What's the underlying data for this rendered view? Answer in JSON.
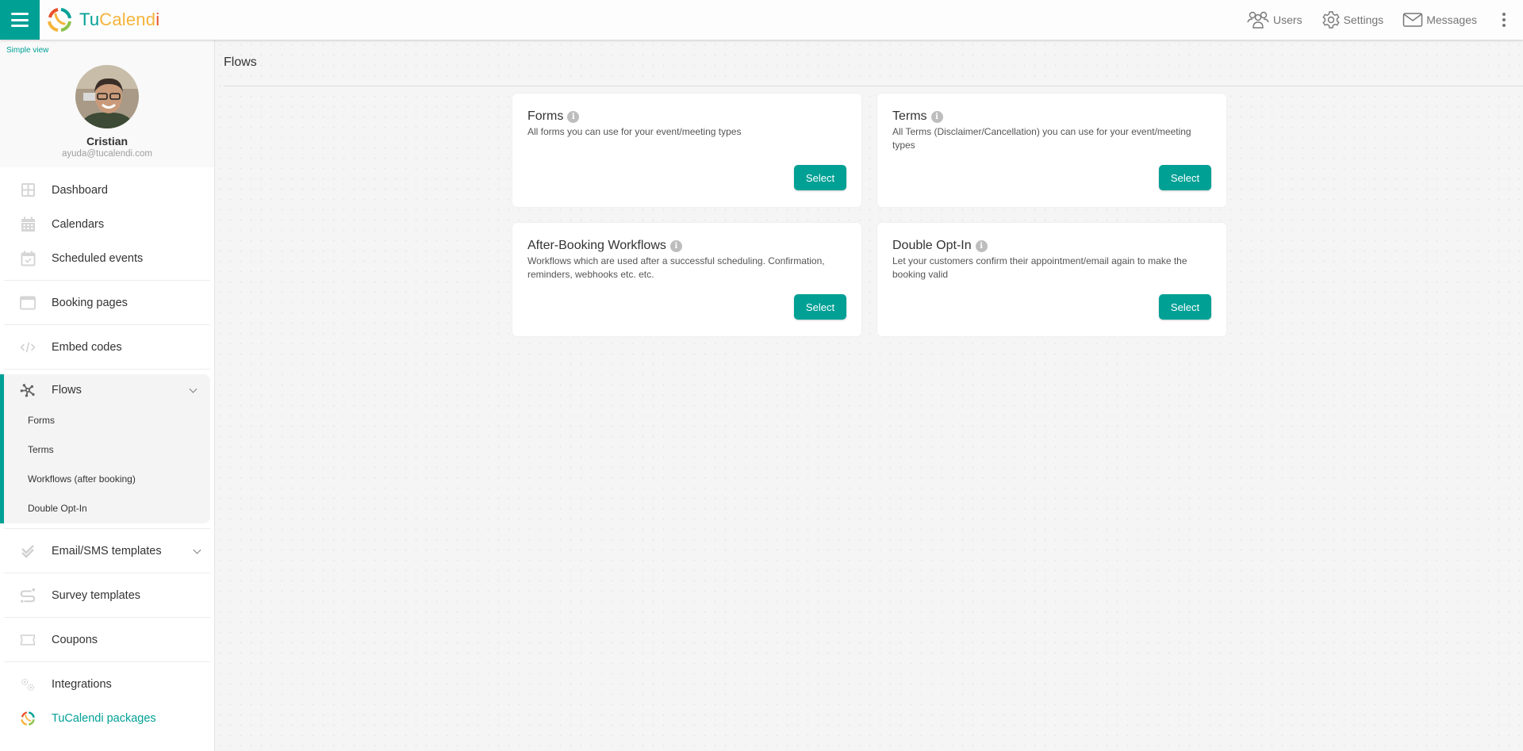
{
  "app": {
    "brand": {
      "part1": "Tu",
      "part2": "Calend",
      "part3": "i"
    },
    "colors": {
      "accent": "#00a095",
      "logo_orange": "#f5b43a",
      "logo_red": "#e8502a",
      "logo_green": "#8bc34a"
    }
  },
  "topnav": {
    "items": [
      {
        "label": "Users",
        "icon": "users-icon"
      },
      {
        "label": "Settings",
        "icon": "gear-icon"
      },
      {
        "label": "Messages",
        "icon": "envelope-icon"
      }
    ]
  },
  "sidebar": {
    "simple_view": "Simple view",
    "profile": {
      "name": "Cristian",
      "email": "ayuda@tucalendi.com"
    },
    "items": [
      {
        "label": "Dashboard",
        "icon": "dashboard-icon"
      },
      {
        "label": "Calendars",
        "icon": "calendar-icon"
      },
      {
        "label": "Scheduled events",
        "icon": "calendar-check-icon"
      },
      {
        "label": "Booking pages",
        "icon": "window-icon"
      },
      {
        "label": "Embed codes",
        "icon": "code-icon"
      },
      {
        "label": "Flows",
        "icon": "flows-icon"
      },
      {
        "label": "Email/SMS templates",
        "icon": "double-check-icon"
      },
      {
        "label": "Survey templates",
        "icon": "survey-icon"
      },
      {
        "label": "Coupons",
        "icon": "ticket-icon"
      },
      {
        "label": "Integrations",
        "icon": "gears-icon"
      },
      {
        "label": "TuCalendi packages",
        "icon": "tucalendi-logo-icon"
      }
    ],
    "flows_sub": [
      {
        "label": "Forms"
      },
      {
        "label": "Terms"
      },
      {
        "label": "Workflows (after booking)"
      },
      {
        "label": "Double Opt-In"
      }
    ]
  },
  "main": {
    "title": "Flows",
    "cards": [
      {
        "title": "Forms",
        "desc": "All forms you can use for your event/meeting types",
        "button": "Select"
      },
      {
        "title": "Terms",
        "desc": "All Terms (Disclaimer/Cancellation) you can use for your event/meeting types",
        "button": "Select"
      },
      {
        "title": "After-Booking Workflows",
        "desc": "Workflows which are used after a successful scheduling. Confirmation, reminders, webhooks etc. etc.",
        "button": "Select"
      },
      {
        "title": "Double Opt-In",
        "desc": "Let your customers confirm their appointment/email again to make the booking valid",
        "button": "Select"
      }
    ]
  }
}
